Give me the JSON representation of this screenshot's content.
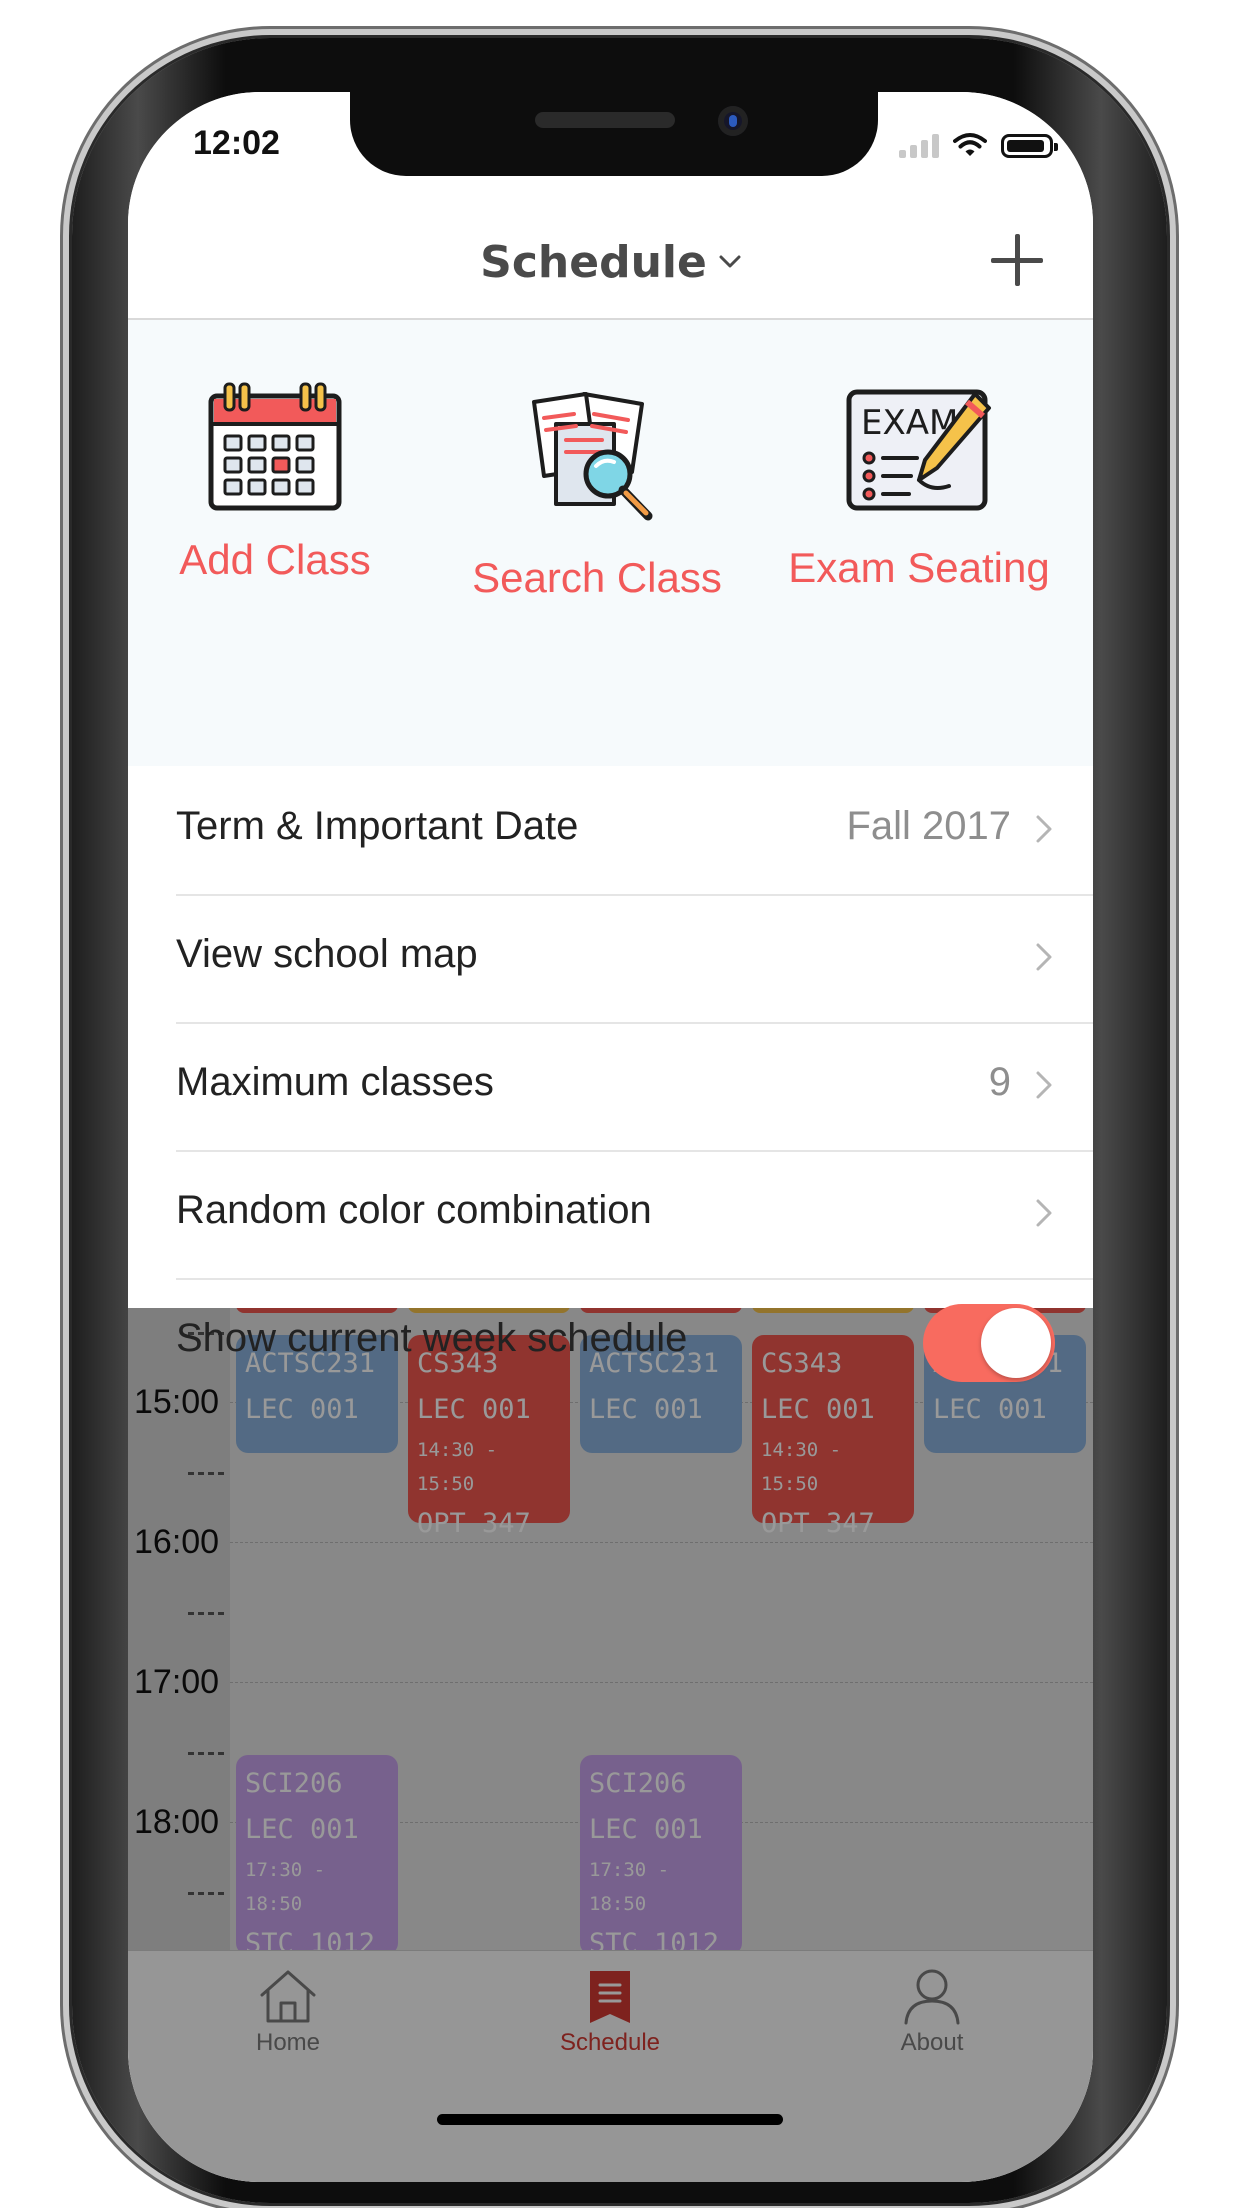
{
  "status_bar": {
    "time": "12:02"
  },
  "nav": {
    "title": "Schedule",
    "add_icon": "plus-icon",
    "dropdown_icon": "chevron-down-icon"
  },
  "quick_actions": [
    {
      "label": "Add Class",
      "icon": "calendar-icon"
    },
    {
      "label": "Search Class",
      "icon": "document-search-icon"
    },
    {
      "label": "Exam Seating",
      "icon": "exam-icon"
    }
  ],
  "settings": {
    "term": {
      "label": "Term & Important Date",
      "value": "Fall 2017"
    },
    "map": {
      "label": "View school map"
    },
    "max_classes": {
      "label": "Maximum classes",
      "value": "9"
    },
    "random_color": {
      "label": "Random color combination"
    },
    "current_week": {
      "label": "Show current week schedule",
      "enabled": true
    }
  },
  "schedule": {
    "times": [
      "15:00",
      "16:00",
      "17:00",
      "18:00"
    ],
    "blocks": {
      "mon_actsc": {
        "course": "ACTSC231",
        "section": "LEC 001"
      },
      "tue_cs": {
        "course": "CS343",
        "section": "LEC 001",
        "time": "14:30 - 15:50",
        "room": "OPT 347"
      },
      "wed_actsc": {
        "course": "ACTSC231",
        "section": "LEC 001"
      },
      "thu_cs": {
        "course": "CS343",
        "section": "LEC 001",
        "time": "14:30 - 15:50",
        "room": "OPT 347"
      },
      "fri_actsc": {
        "course": "ACTSC231",
        "section": "LEC 001"
      },
      "mon_sci": {
        "course": "SCI206",
        "section": "LEC 001",
        "time": "17:30 - 18:50",
        "room": "STC 1012"
      },
      "wed_sci": {
        "course": "SCI206",
        "section": "LEC 001",
        "time": "17:30 - 18:50",
        "room": "STC 1012"
      }
    }
  },
  "tabs": [
    {
      "label": "Home",
      "icon": "home-icon",
      "active": false
    },
    {
      "label": "Schedule",
      "icon": "bookmark-list-icon",
      "active": true
    },
    {
      "label": "About",
      "icon": "person-icon",
      "active": false
    }
  ],
  "colors": {
    "accent": "#f25a5a",
    "toggle_on": "#f86b5f",
    "class_blue": "#8ab1dc",
    "class_red": "#f1574f",
    "class_purple": "#c7a2eb",
    "tab_active": "#d33a33"
  }
}
